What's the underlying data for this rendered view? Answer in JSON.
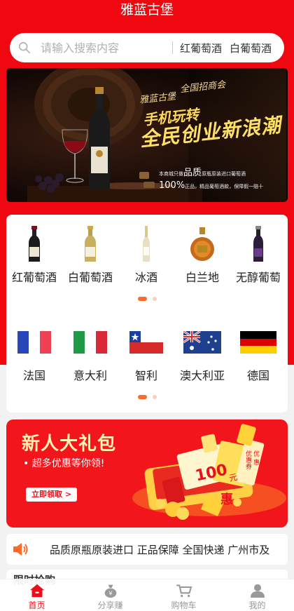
{
  "header": {
    "title": "雅蓝古堡"
  },
  "search": {
    "placeholder": "请输入搜索内容",
    "hot_keywords": [
      "红葡萄酒",
      "白葡萄酒"
    ]
  },
  "banner": {
    "brand": "雅蓝古堡",
    "tag": "全国招商会",
    "slogan_line1": "手机玩转",
    "slogan_line2": "全民创业新浪潮",
    "promise_prefix": "本商城只做",
    "promise_em": "品质",
    "promise_suffix": "原瓶原装进口葡萄酒",
    "guarantee_em": "100%",
    "guarantee_text": "正品，精品葡萄酒款，保障假一赔十"
  },
  "categories": [
    {
      "label": "红葡萄酒",
      "icon": "red-wine-bottle-icon"
    },
    {
      "label": "白葡萄酒",
      "icon": "white-wine-bottle-icon"
    },
    {
      "label": "冰酒",
      "icon": "ice-wine-bottle-icon"
    },
    {
      "label": "白兰地",
      "icon": "brandy-bottle-icon"
    },
    {
      "label": "无醇葡萄",
      "icon": "non-alcoholic-wine-icon"
    }
  ],
  "countries": [
    {
      "label": "法国",
      "icon": "france-flag-icon"
    },
    {
      "label": "意大利",
      "icon": "italy-flag-icon"
    },
    {
      "label": "智利",
      "icon": "chile-flag-icon"
    },
    {
      "label": "澳大利亚",
      "icon": "australia-flag-icon"
    },
    {
      "label": "德国",
      "icon": "germany-flag-icon"
    }
  ],
  "promo": {
    "title": "新人大礼包",
    "subtitle": "• 超多优惠等你领!",
    "button": "立即领取 >",
    "coupon_100": "100",
    "coupon_yuan": "元",
    "coupon_hui": "惠",
    "coupon_side": "优惠券",
    "coupon_side2": "优 惠"
  },
  "notice": {
    "text": "品质原瓶原装进口 正品保障 全国快递 广州市及"
  },
  "section_peek": {
    "title": "限时抢购"
  },
  "tabbar": [
    {
      "label": "首页",
      "icon": "home-icon",
      "active": true
    },
    {
      "label": "分享赚",
      "icon": "money-bag-icon",
      "active": false
    },
    {
      "label": "购物车",
      "icon": "cart-icon",
      "active": false
    },
    {
      "label": "我的",
      "icon": "user-icon",
      "active": false
    }
  ],
  "colors": {
    "brand_red": "#f0070f",
    "accent_orange": "#ff6a2a",
    "gold": "#ffd95a"
  }
}
